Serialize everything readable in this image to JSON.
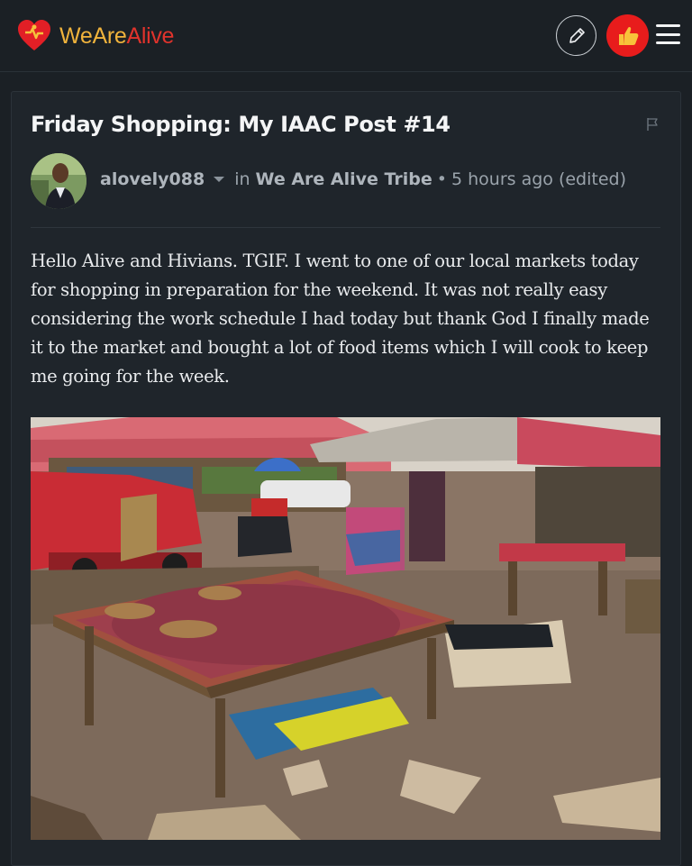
{
  "header": {
    "logo_part1": "WeAre",
    "logo_part2": "Alive",
    "logo_icon": "heart-logo-icon",
    "edit_icon": "pencil-icon",
    "user_icon": "thumbs-up-icon",
    "menu_icon": "hamburger-menu-icon",
    "accent_color": "#e81c1c",
    "brand_yellow": "#f0b33c"
  },
  "post": {
    "title": "Friday Shopping: My IAAC Post #14",
    "flag_icon": "flag-icon",
    "author": "alovely088",
    "in_label": "in",
    "community": "We Are Alive Tribe",
    "separator": "•",
    "timestamp": "5 hours ago (edited)",
    "body": "Hello Alive and Hivians. TGIF. I went to one of our local markets today for shopping in preparation for the weekend. It was not really easy considering the work schedule I had today but thank God I finally made it to the market and bought a lot of food items which I will cook to keep me going for the week."
  }
}
